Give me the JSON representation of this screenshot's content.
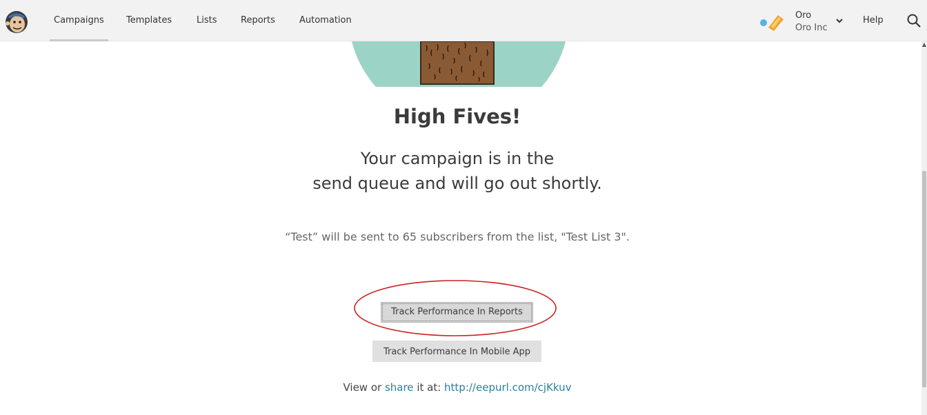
{
  "nav": {
    "items": [
      {
        "label": "Campaigns",
        "active": true
      },
      {
        "label": "Templates",
        "active": false
      },
      {
        "label": "Lists",
        "active": false
      },
      {
        "label": "Reports",
        "active": false
      },
      {
        "label": "Automation",
        "active": false
      }
    ],
    "account": {
      "name": "Oro",
      "org": "Oro Inc"
    },
    "help_label": "Help",
    "icons": {
      "logo": "mailchimp-logo-icon",
      "account_logo": "account-logo-icon",
      "chevron": "chevron-down-icon",
      "search": "search-icon"
    }
  },
  "main": {
    "headline": "High Fives!",
    "subline_1": "Your campaign is in the",
    "subline_2": "send queue and will go out shortly.",
    "info": "“Test” will be sent to 65 subscribers from the list, \"Test List 3\".",
    "btn_reports": "Track Performance In Reports",
    "btn_mobile": "Track Performance In Mobile App",
    "share": {
      "prefix": "View or ",
      "share_link": "share",
      "middle": " it at: ",
      "url": "http://eepurl.com/cjKkuv"
    }
  },
  "colors": {
    "accent_link": "#2a7f9e",
    "annotation": "#cc1f1f",
    "illustration_teal": "#9bd4c6",
    "trunk": "#8a5a34"
  }
}
